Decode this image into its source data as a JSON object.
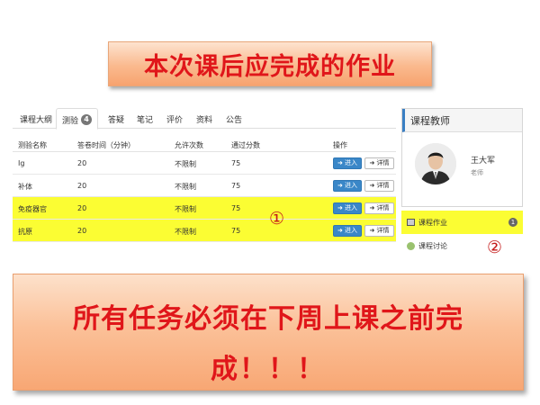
{
  "top_banner": {
    "text": "本次课后应完成的作业"
  },
  "tabs": [
    {
      "label": "课程大纲"
    },
    {
      "label": "测验",
      "badge": "4",
      "active": true
    },
    {
      "label": "答疑"
    },
    {
      "label": "笔记"
    },
    {
      "label": "评价"
    },
    {
      "label": "资料"
    },
    {
      "label": "公告"
    }
  ],
  "table": {
    "headers": [
      "测验名称",
      "答卷时间（分钟）",
      "允许次数",
      "通过分数",
      "操作"
    ],
    "rows": [
      {
        "name": "Ig",
        "time": "20",
        "attempts": "不限制",
        "score": "75",
        "highlight": false
      },
      {
        "name": "补体",
        "time": "20",
        "attempts": "不限制",
        "score": "75",
        "highlight": false
      },
      {
        "name": "免疫器官",
        "time": "20",
        "attempts": "不限制",
        "score": "75",
        "highlight": true
      },
      {
        "name": "抗原",
        "time": "20",
        "attempts": "不限制",
        "score": "75",
        "highlight": true
      }
    ],
    "enter_label": "进入",
    "detail_label": "详情"
  },
  "markers": {
    "one": "①",
    "two": "②"
  },
  "teacher": {
    "title": "课程教师",
    "name": "王大军",
    "role": "老师"
  },
  "side_menu": [
    {
      "label": "课程作业",
      "badge": "1",
      "highlight": true,
      "icon": "document-icon"
    },
    {
      "label": "课程讨论",
      "highlight": false,
      "icon": "chat-icon"
    }
  ],
  "bottom_banner": {
    "line1": "所有任务必须在下周上课之前完",
    "line2": "成！！！"
  },
  "colors": {
    "banner_text": "#e0161a",
    "highlight": "#fbfd33",
    "primary_button": "#3a87c8"
  }
}
